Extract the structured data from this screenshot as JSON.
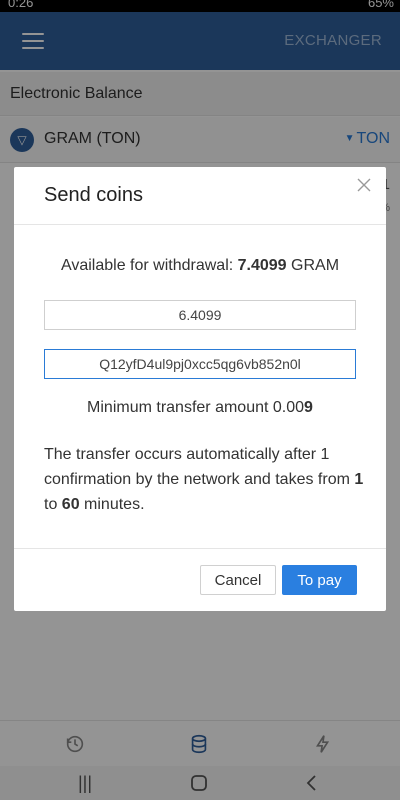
{
  "status_bar": {
    "time": "0:26",
    "battery": "65%"
  },
  "app_bar": {
    "title": "EXCHANGER"
  },
  "balance_section": {
    "title": "Electronic Balance"
  },
  "currency_row": {
    "name": "GRAM (TON)",
    "selected": "TON"
  },
  "background_peek": {
    "value": "1",
    "percent": "%"
  },
  "dialog": {
    "title": "Send coins",
    "available_label": "Available for withdrawal: ",
    "available_amount": "7.4099",
    "available_unit": " GRAM",
    "amount_value": "6.4099",
    "address_value": "Q12yfD4ul9pj0xcc5qg6vb852n0l",
    "min_transfer_label": "Minimum transfer amount 0.00",
    "min_transfer_bold": "9",
    "info_part1": "The transfer occurs automatically after 1 confirmation by the network and takes from ",
    "info_min": "1",
    "info_to": " to ",
    "info_max": "60",
    "info_part2": " minutes.",
    "cancel_label": "Cancel",
    "pay_label": "To pay"
  },
  "colors": {
    "app_bar": "#2f5f9c",
    "accent": "#2a7fe0",
    "link": "#2a7bd6"
  },
  "tab_bar": {
    "icons": [
      "history-icon",
      "database-icon",
      "flash-icon"
    ]
  },
  "nav_bar": {
    "icons": [
      "recent-apps-icon",
      "home-icon",
      "back-icon"
    ]
  }
}
